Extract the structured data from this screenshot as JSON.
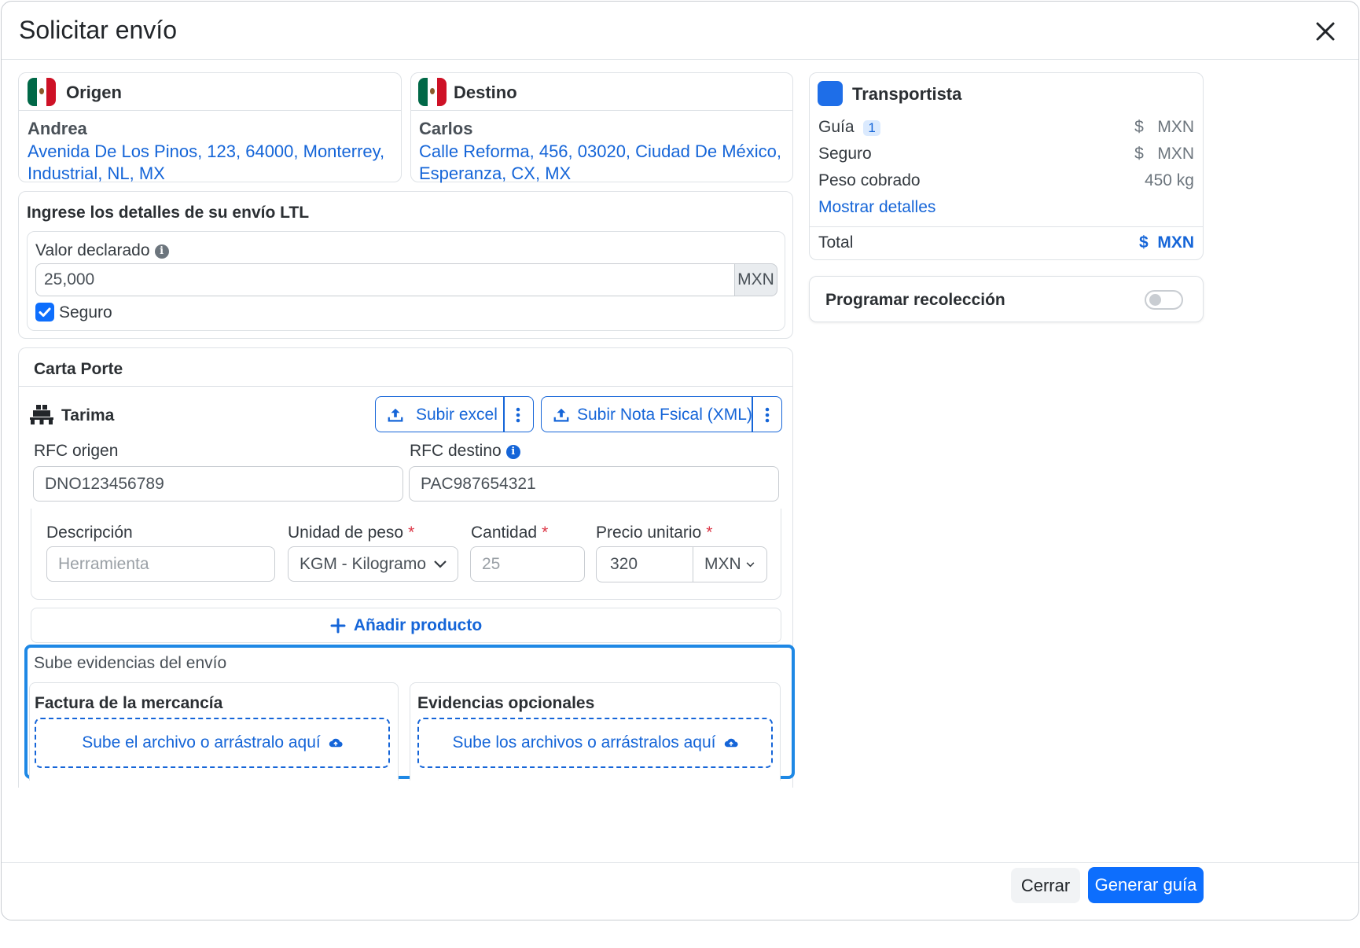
{
  "modal": {
    "title": "Solicitar envío"
  },
  "origin": {
    "title": "Origen",
    "name": "Andrea",
    "address_line1": "Avenida De Los Pinos, 123, 64000, Monterrey,",
    "address_line2": "Industrial, NL, MX"
  },
  "destination": {
    "title": "Destino",
    "name": "Carlos",
    "address_line1": "Calle Reforma, 456, 03020, Ciudad De México,",
    "address_line2": "Esperanza, CX, MX"
  },
  "ltl": {
    "title": "Ingrese los detalles de su envío LTL",
    "declared_value_label": "Valor declarado",
    "declared_value": "25,000",
    "currency": "MXN",
    "insurance_label": "Seguro",
    "insurance_checked": true
  },
  "carta_porte": {
    "title": "Carta Porte",
    "pallet_label": "Tarima",
    "upload_excel": "Subir excel",
    "upload_xml": "Subir Nota Fsical (XML)",
    "rfc_origin_label": "RFC origen",
    "rfc_origin": "DNO123456789",
    "rfc_destination_label": "RFC destino",
    "rfc_destination": "PAC987654321",
    "product": {
      "description_label": "Descripción",
      "description_placeholder": "Herramienta",
      "weight_unit_label": "Unidad de peso",
      "weight_unit": "KGM - Kilogramo",
      "quantity_label": "Cantidad",
      "quantity_placeholder": "25",
      "unit_price_label": "Precio unitario",
      "unit_price": "320",
      "unit_price_currency": "MXN",
      "required_mark": "*"
    },
    "add_product": "Añadir producto"
  },
  "evidence": {
    "title": "Sube evidencias del envío",
    "invoice_title": "Factura de la mercancía",
    "invoice_drop": "Sube el archivo o arrástralo aquí",
    "optional_title": "Evidencias opcionales",
    "optional_drop": "Sube los archivos o arrástralos aquí"
  },
  "carrier": {
    "title": "Transportista",
    "guide_label": "Guía",
    "guide_badge": "1",
    "guide_value": "$   MXN",
    "insurance_label": "Seguro",
    "insurance_value": "$   MXN",
    "weight_label": "Peso cobrado",
    "weight_value": "450 kg",
    "show_details": "Mostrar detalles",
    "total_label": "Total",
    "total_value": "$  MXN"
  },
  "pickup": {
    "label": "Programar recolección",
    "enabled": false
  },
  "footer": {
    "close": "Cerrar",
    "generate": "Generar guía"
  },
  "colors": {
    "primary": "#1565d8",
    "highlight": "#1e88e5",
    "carrier_square": "#1e6ee8"
  }
}
